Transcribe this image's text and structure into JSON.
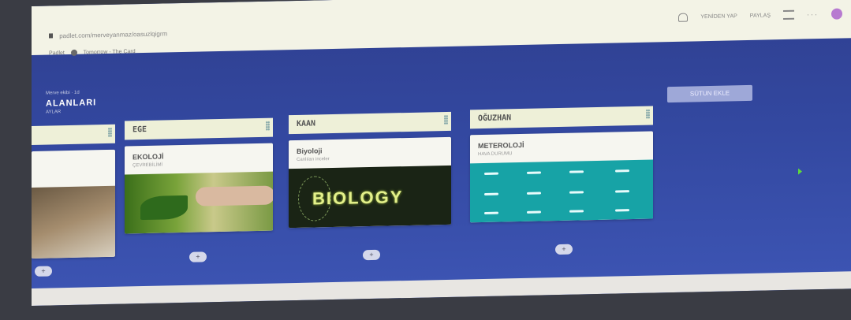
{
  "browser": {
    "url": "padlet.com/merveyanmaz/oasuzlqigrm",
    "bookmarks": [
      "Padlet",
      "Tomorrow - The Card"
    ]
  },
  "toolbar": {
    "remake_label": "YENİDEN YAP",
    "share_label": "PAYLAŞ"
  },
  "board": {
    "crumb": "Merve ekibi · 1d",
    "title": "ALANLARI",
    "subtitle": "AYLAR"
  },
  "columns": [
    {
      "header": "",
      "card": {
        "title": "",
        "subtitle": "",
        "image": "rocky-landscape-photo"
      }
    },
    {
      "header": "EGE",
      "card": {
        "title": "EKOLOJİ",
        "subtitle": "ÇEVREBİLİMİ",
        "image": "hand-with-plant-photo"
      }
    },
    {
      "header": "KAAN",
      "card": {
        "title": "Biyoloji",
        "subtitle": "Canlıları inceler",
        "image": "biology-poster",
        "image_text": "BIOLOGY"
      }
    },
    {
      "header": "OĞUZHAN",
      "card": {
        "title": "METEROLOJİ",
        "subtitle": "HAVA DURUMU",
        "image": "weather-icons-grid"
      }
    }
  ],
  "add_column_label": "SÜTUN EKLE",
  "add_post_symbol": "+",
  "colors": {
    "board_bg": "#3348a0",
    "column_header_bg": "#eef0d8",
    "weather_bg": "#17a3a6"
  }
}
